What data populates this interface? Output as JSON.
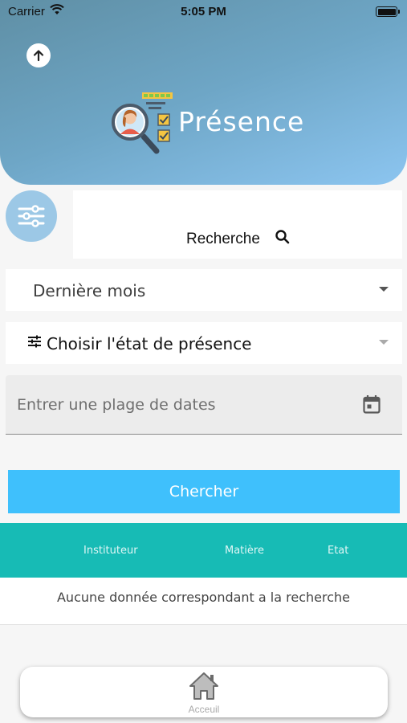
{
  "status_bar": {
    "carrier": "Carrier",
    "time": "5:05 PM"
  },
  "header": {
    "title": "Présence"
  },
  "search": {
    "label": "Recherche"
  },
  "filters": {
    "period_selected": "Dernière mois",
    "state_placeholder": "Choisir l'état de présence",
    "date_range_placeholder": "Entrer une plage de dates"
  },
  "actions": {
    "search_button": "Chercher"
  },
  "table": {
    "columns": [
      "Instituteur",
      "Matière",
      "Etat"
    ],
    "empty_message": "Aucune donnée correspondant a la recherche"
  },
  "bottom_nav": {
    "home_label": "Acceuil"
  },
  "colors": {
    "header_gradient_start": "#5f8fa5",
    "header_gradient_end": "#8cc5f0",
    "primary_button": "#3fc0fc",
    "table_header": "#17bbb5",
    "filter_fab": "#9cc8e6"
  }
}
